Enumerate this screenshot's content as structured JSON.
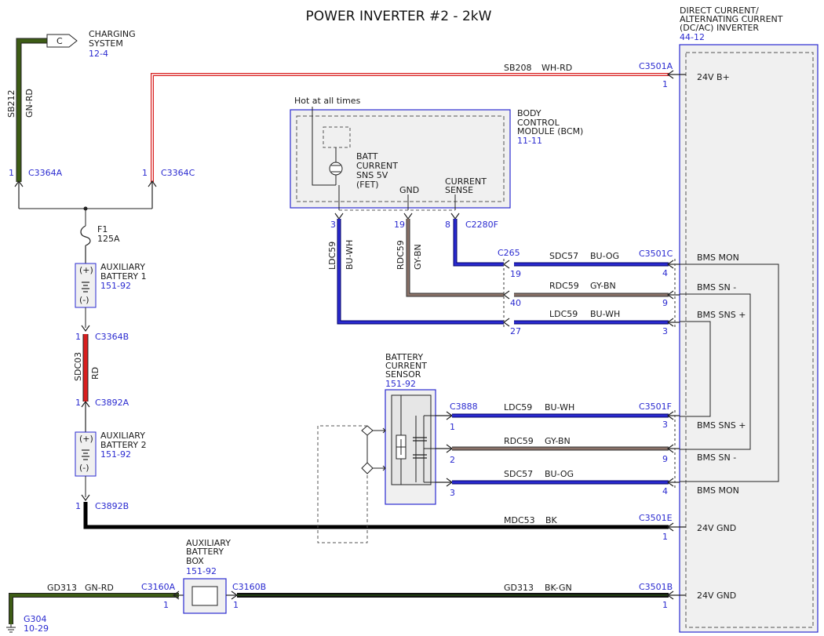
{
  "title": "POWER INVERTER #2 - 2kW",
  "colors": {
    "blue": "#2a2ad0",
    "green": "#3d5c15",
    "red": "#d81e1e",
    "gray_brown": "#8a7268",
    "black": "#000000",
    "box_fill": "#f0f0f0"
  },
  "charging_system": {
    "connector": "C",
    "name_line1": "CHARGING",
    "name_line2": "SYSTEM",
    "ref": "12-4"
  },
  "sb212": {
    "circuit": "SB212",
    "color": "GN-RD"
  },
  "c3364a": {
    "pin": "1",
    "name": "C3364A"
  },
  "c3364c": {
    "pin": "1",
    "name": "C3364C"
  },
  "sb208": {
    "circuit": "SB208",
    "color": "WH-RD"
  },
  "fuse": {
    "name": "F1",
    "rating": "125A"
  },
  "aux_battery_1": {
    "plus": "(+)",
    "minus": "(-)",
    "line1": "AUXILIARY",
    "line2": "BATTERY 1",
    "ref": "151-92"
  },
  "c3364b": {
    "pin": "1",
    "name": "C3364B"
  },
  "sdc03": {
    "circuit": "SDC03",
    "color": "RD"
  },
  "c3892a": {
    "pin": "1",
    "name": "C3892A"
  },
  "aux_battery_2": {
    "plus": "(+)",
    "minus": "(-)",
    "line1": "AUXILIARY",
    "line2": "BATTERY 2",
    "ref": "151-92"
  },
  "c3892b": {
    "pin": "1",
    "name": "C3892B"
  },
  "bcm": {
    "hot_label": "Hot at all times",
    "line1": "BODY",
    "line2": "CONTROL",
    "line3": "MODULE (BCM)",
    "ref": "11-11",
    "batt_line1": "BATT",
    "batt_line2": "CURRENT",
    "batt_line3": "SNS 5V",
    "batt_line4": "(FET)",
    "gnd": "GND",
    "cs_line1": "CURRENT",
    "cs_line2": "SENSE",
    "pin3": "3",
    "pin19": "19",
    "pin8": "8",
    "connector": "C2280F"
  },
  "ldc59_vertical": {
    "circuit": "LDC59",
    "color": "BU-WH"
  },
  "rdc59_vertical": {
    "circuit": "RDC59",
    "color": "GY-BN"
  },
  "c265": {
    "name": "C265",
    "pin19": "19",
    "pin40": "40",
    "pin27": "27"
  },
  "c3501c": {
    "name": "C3501C",
    "pin4": "4",
    "pin9": "9",
    "pin3": "3"
  },
  "wire_sdc57_a": {
    "circuit": "SDC57",
    "color": "BU-OG"
  },
  "wire_rdc59_a": {
    "circuit": "RDC59",
    "color": "GY-BN"
  },
  "wire_ldc59_a": {
    "circuit": "LDC59",
    "color": "BU-WH"
  },
  "battery_current_sensor": {
    "line1": "BATTERY",
    "line2": "CURRENT",
    "line3": "SENSOR",
    "ref": "151-92"
  },
  "c3888": {
    "name": "C3888",
    "pin1": "1",
    "pin2": "2",
    "pin3": "3"
  },
  "c3501f": {
    "name": "C3501F",
    "pin3": "3",
    "pin9": "9",
    "pin4": "4"
  },
  "wire_ldc59_b": {
    "circuit": "LDC59",
    "color": "BU-WH"
  },
  "wire_rdc59_b": {
    "circuit": "RDC59",
    "color": "GY-BN"
  },
  "wire_sdc57_b": {
    "circuit": "SDC57",
    "color": "BU-OG"
  },
  "mdc53": {
    "circuit": "MDC53",
    "color": "BK"
  },
  "c3501e": {
    "name": "C3501E",
    "pin": "1"
  },
  "gd313_left": {
    "circuit": "GD313",
    "color": "GN-RD"
  },
  "c3160a": {
    "name": "C3160A",
    "pin": "1"
  },
  "aux_battery_box": {
    "line1": "AUXILIARY",
    "line2": "BATTERY",
    "line3": "BOX",
    "ref": "151-92"
  },
  "c3160b": {
    "name": "C3160B",
    "pin": "1"
  },
  "gd313_right": {
    "circuit": "GD313",
    "color": "BK-GN"
  },
  "c3501b": {
    "name": "C3501B",
    "pin": "1"
  },
  "c3501a": {
    "name": "C3501A",
    "pin": "1"
  },
  "g304": {
    "name": "G304",
    "ref": "10-29"
  },
  "inverter": {
    "line1": "DIRECT CURRENT/",
    "line2": "ALTERNATING CURRENT",
    "line3": "(DC/AC) INVERTER",
    "ref": "44-12",
    "pins": {
      "b_plus": "24V B+",
      "bms_mon_1": "BMS MON",
      "bms_sn_minus_1": "BMS SN -",
      "bms_sns_plus_1": "BMS SNS +",
      "bms_sns_plus_2": "BMS SNS +",
      "bms_sn_minus_2": "BMS SN -",
      "bms_mon_2": "BMS MON",
      "gnd_1": "24V GND",
      "gnd_2": "24V GND"
    }
  }
}
